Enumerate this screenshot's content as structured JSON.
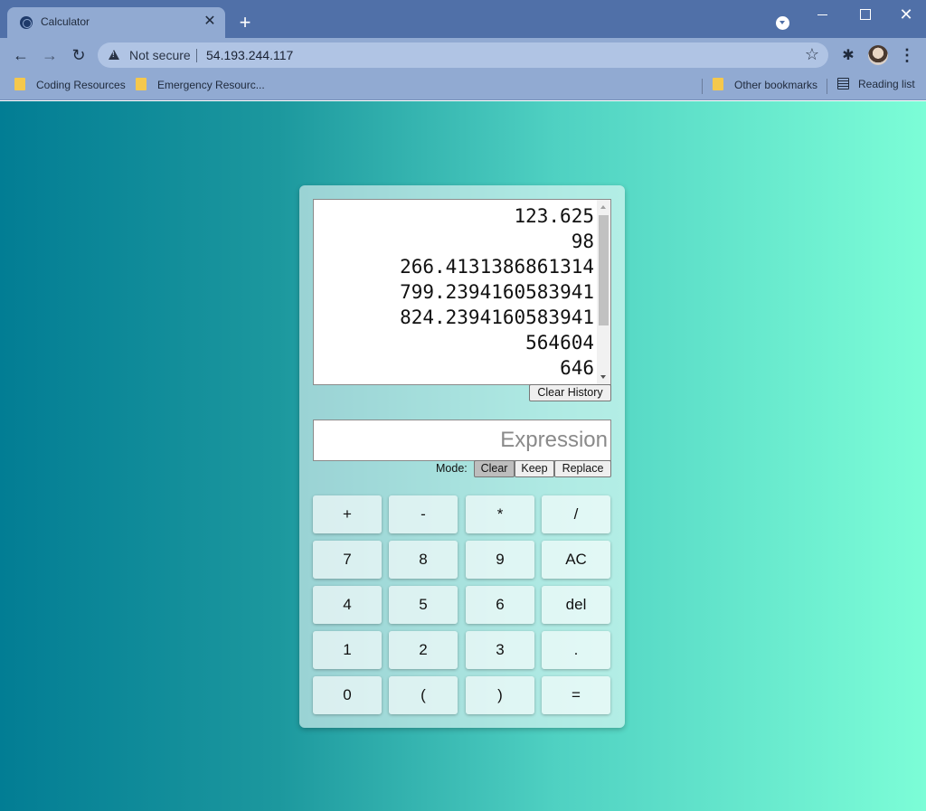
{
  "browser": {
    "tab_title": "Calculator",
    "tab_close": "✕",
    "new_tab": "+",
    "not_secure": "Not secure",
    "url": "54.193.244.117",
    "star": "☆",
    "extensions": "✱",
    "menu": "⋮",
    "bookmarks": {
      "coding": "Coding Resources",
      "emergency": "Emergency Resourc...",
      "other": "Other bookmarks",
      "reading": "Reading list"
    },
    "icons": {
      "back": "←",
      "forward": "→",
      "reload": "↻",
      "close_window": "✕"
    }
  },
  "calculator": {
    "history": [
      "123.625",
      "98",
      "266.4131386861314",
      "799.2394160583941",
      "824.2394160583941",
      "564604",
      "646"
    ],
    "clear_history_label": "Clear History",
    "expression_placeholder": "Expression",
    "mode_label": "Mode:",
    "mode_buttons": [
      "Clear",
      "Keep",
      "Replace"
    ],
    "mode_selected": "Clear",
    "keys": [
      [
        "+",
        "-",
        "*",
        "/"
      ],
      [
        "7",
        "8",
        "9",
        "AC"
      ],
      [
        "4",
        "5",
        "6",
        "del"
      ],
      [
        "1",
        "2",
        "3",
        "."
      ],
      [
        "0",
        "(",
        ")",
        "="
      ]
    ]
  }
}
